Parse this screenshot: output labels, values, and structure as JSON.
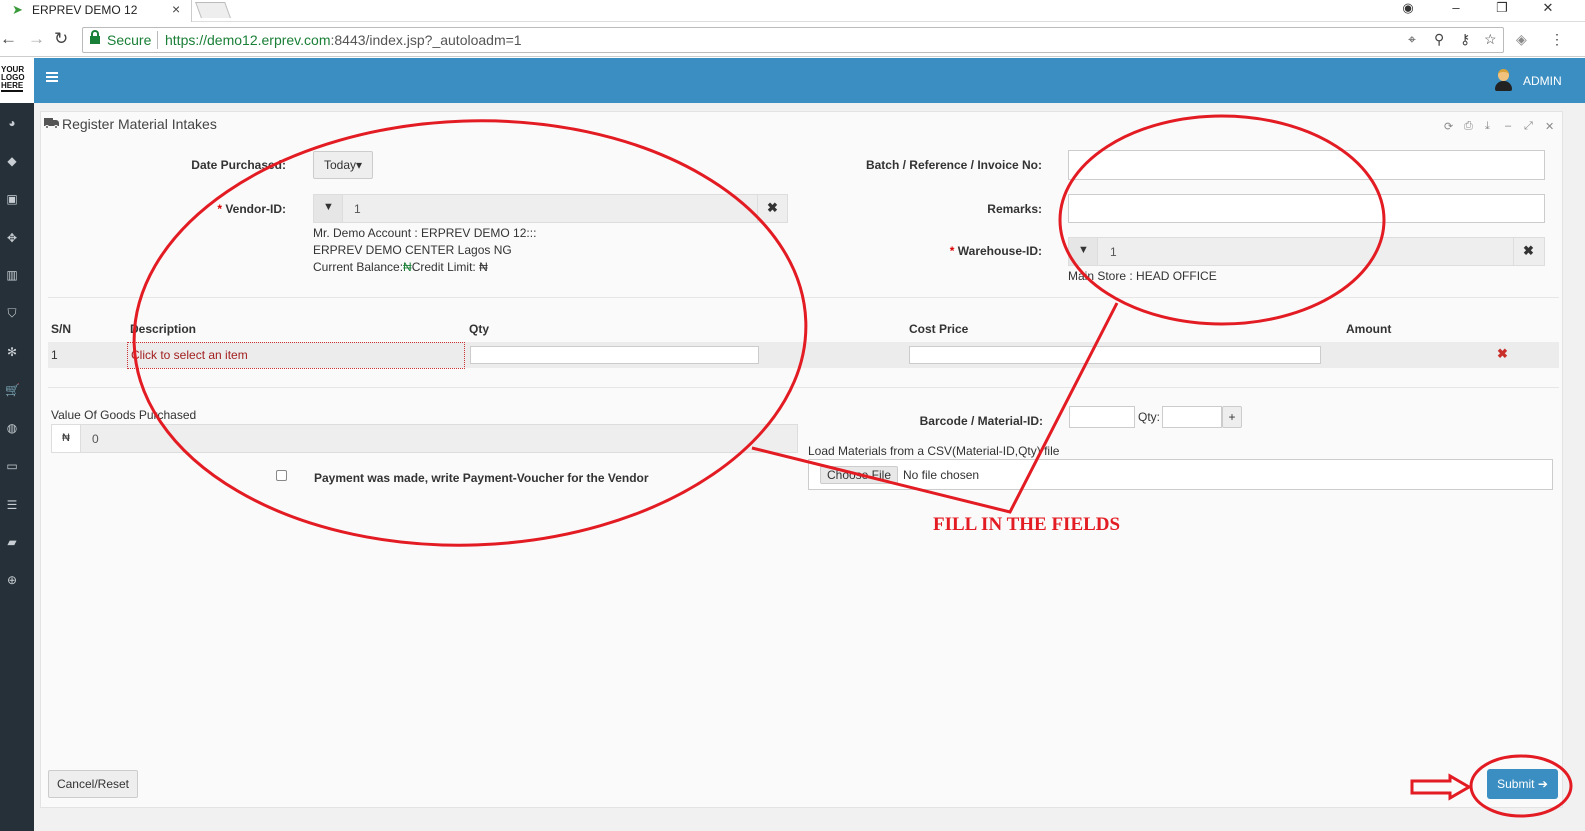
{
  "browser": {
    "tab_title": "ERPREV DEMO 12",
    "secure_label": "Secure",
    "url_scheme_host": "https://demo12.erprev.com",
    "url_rest": ":8443/index.jsp?_autoloadm=1"
  },
  "header": {
    "logo_lines": [
      "YOUR",
      "LOGO",
      "HERE"
    ],
    "user_label": "ADMIN"
  },
  "sidebar": {
    "icons": [
      "dashboard-icon",
      "tag-icon",
      "money-icon",
      "cubes-icon",
      "building-icon",
      "shield-icon",
      "snowflake-icon",
      "cart-icon",
      "disc-icon",
      "monitor-icon",
      "database-icon",
      "book-icon",
      "lifebuoy-icon"
    ]
  },
  "panel": {
    "title": "Register Material Intakes"
  },
  "form": {
    "date_label": "Date Purchased:",
    "date_value": "Today",
    "vendor_label": "Vendor-ID:",
    "vendor_value": "1",
    "vendor_info_1": "Mr. Demo Account : ERPREV DEMO 12:::",
    "vendor_info_2": "ERPREV DEMO CENTER Lagos NG",
    "vendor_info_3_a": "Current Balance:",
    "vendor_info_3_b": "Credit Limit:",
    "currency_symbol": "₦",
    "batch_label": "Batch / Reference / Invoice No:",
    "remarks_label": "Remarks:",
    "warehouse_label": "Warehouse-ID:",
    "warehouse_value": "1",
    "warehouse_info": "Main Store : HEAD OFFICE",
    "required_mark": "*"
  },
  "table": {
    "columns": [
      "S/N",
      "Description",
      "Qty",
      "Cost Price",
      "Amount"
    ],
    "rows": [
      {
        "sn": "1",
        "description": "Click to select an item"
      }
    ]
  },
  "lower": {
    "value_label": "Value Of Goods Purchased",
    "value_prefix": "₦",
    "value_amount": "0",
    "payment_label": "Payment was made, write Payment-Voucher for the Vendor",
    "barcode_label": "Barcode / Material-ID:",
    "qty_label": "Qty:",
    "add_label": "+",
    "csv_label": "Load Materials from a CSV(Material-ID,Qty) file",
    "choose_file": "Choose File",
    "no_file": "No file chosen"
  },
  "footer": {
    "cancel_label": "Cancel/Reset",
    "submit_label": "Submit"
  },
  "annotation": {
    "text": "FILL IN THE FIELDS",
    "color": "#e31b23"
  },
  "colors": {
    "header": "#3a8ec1",
    "sidebar": "#253038",
    "secure_green": "#1a7f37",
    "danger": "#c9302c"
  }
}
